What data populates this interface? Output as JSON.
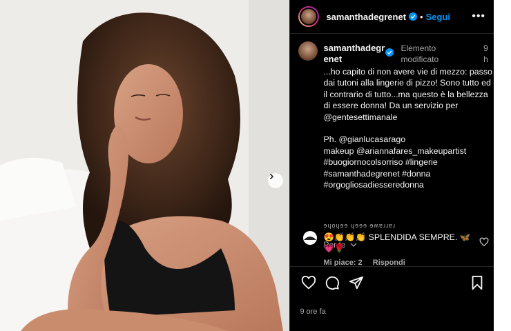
{
  "post": {
    "username": "samanthadegrenet",
    "follow_label": "Segui",
    "more_label": "•••"
  },
  "caption": {
    "username": "samanthadegrenet",
    "edited_label": "Elemento modificato",
    "time": "9 h",
    "lines": [
      "...ho capito di non avere vie di mezzo: passo dai tutoni alla lingerie di pizzo! Sono tutto ed il contrario di tutto...ma questo è la bellezza di essere donna! Da un servizio per @gentesettimanale",
      "Ph. @gianlucasarago",
      "makeup @ariannafares_makeupartist",
      "#buogiornocolsorriso #lingerie",
      "#samanthadegrenet #donna",
      "#orgogliosadiesseredonna"
    ],
    "see_more": "Per te"
  },
  "comment": {
    "username": "ɘɥoɥɘɘ ɥɘɘɘ ɘʍɐɹɹɐɹ",
    "text": "😍👏👏👏 SPLENDIDA SEMPRE. 🦋💗🌹",
    "likes": "Mi piace: 2",
    "reply": "Rispondi"
  },
  "footer": {
    "timestamp": "9 ore fa"
  },
  "icons": {
    "like": "heart-icon",
    "comment": "comment-icon",
    "share": "send-icon",
    "save": "bookmark-icon",
    "verified": "verified-badge-icon",
    "next": "chevron-right-icon"
  },
  "colors": {
    "accent": "#0095f6",
    "background": "#000000",
    "muted": "#a8a8a8"
  }
}
